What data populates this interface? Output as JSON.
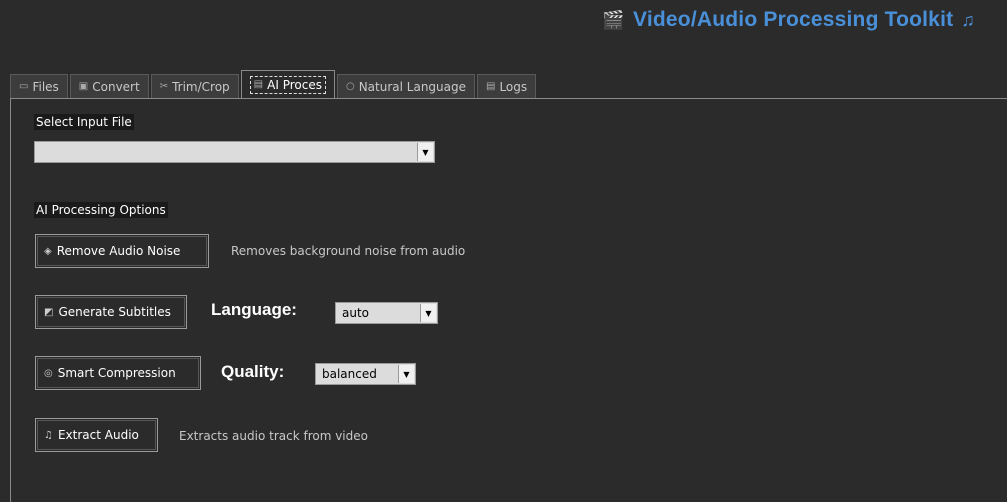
{
  "app": {
    "title": "Video/Audio Processing Toolkit",
    "title_left_icon": "clapperboard-icon",
    "title_right_icon": "music-note-icon",
    "accent_color": "#4a90d9"
  },
  "tabs": [
    {
      "label": "Files",
      "icon": "folder-icon"
    },
    {
      "label": "Convert",
      "icon": "convert-icon"
    },
    {
      "label": "Trim/Crop",
      "icon": "scissors-icon"
    },
    {
      "label": "AI Proces",
      "icon": "ai-icon",
      "active": true
    },
    {
      "label": "Natural Language",
      "icon": "speech-icon"
    },
    {
      "label": "Logs",
      "icon": "document-icon"
    }
  ],
  "input": {
    "label": "Select Input File",
    "value": ""
  },
  "options": {
    "header": "AI Processing Options",
    "remove_noise": {
      "label": "Remove Audio Noise",
      "description": "Removes background noise from audio"
    },
    "subtitles": {
      "label": "Generate Subtitles",
      "param_label": "Language:",
      "value": "auto"
    },
    "compression": {
      "label": "Smart Compression",
      "param_label": "Quality:",
      "value": "balanced"
    },
    "extract_audio": {
      "label": "Extract Audio",
      "description": "Extracts audio track from video"
    }
  }
}
